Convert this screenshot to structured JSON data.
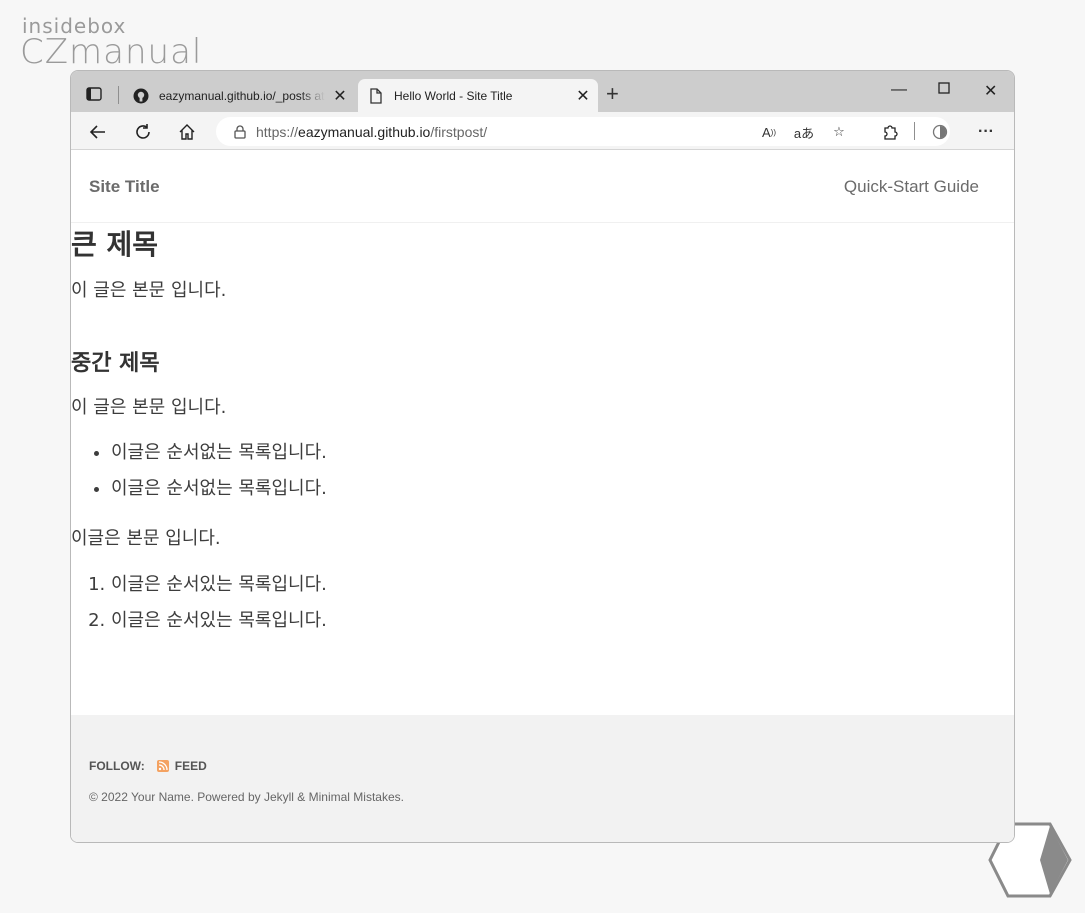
{
  "watermark": {
    "line1": "insidebox",
    "line2": "CZmanual"
  },
  "tabs": [
    {
      "title": "eazymanual.github.io/_posts at m",
      "favicon": "github-icon"
    },
    {
      "title": "Hello World - Site Title",
      "favicon": "page-icon"
    }
  ],
  "address_bar": {
    "scheme": "https://",
    "host": "eazymanual.github.io",
    "path": "/firstpost/"
  },
  "site": {
    "title": "Site Title",
    "nav": "Quick-Start Guide"
  },
  "article": {
    "h1": "큰 제목",
    "p1": "이 글은 본문 입니다.",
    "h2": "중간 제목",
    "p2": "이 글은 본문 입니다.",
    "ul": [
      "이글은 순서없는 목록입니다.",
      "이글은 순서없는 목록입니다."
    ],
    "p3": "이글은 본문 입니다.",
    "ol": [
      "이글은 순서있는 목록입니다.",
      "이글은 순서있는 목록입니다."
    ]
  },
  "footer": {
    "follow_label": "FOLLOW:",
    "feed_label": "FEED",
    "copyright": "© 2022 Your Name. Powered by Jekyll & Minimal Mistakes."
  },
  "colors": {
    "accent_rss": "#f4a261",
    "text": "#3d3d3d"
  }
}
